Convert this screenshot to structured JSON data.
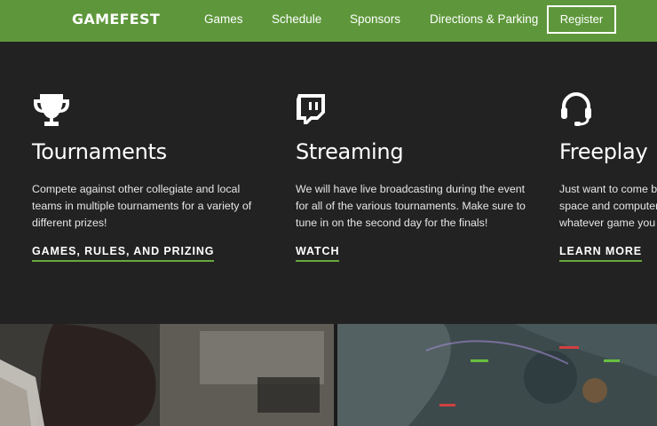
{
  "header": {
    "logo": "GAMEFEST",
    "nav": [
      "Games",
      "Schedule",
      "Sponsors",
      "Directions & Parking"
    ],
    "register_label": "Register"
  },
  "features": [
    {
      "icon": "trophy-icon",
      "title": "Tournaments",
      "body": "Compete against other collegiate and local teams in multiple tournaments for a variety of different prizes!",
      "cta": "GAMES, RULES, AND PRIZING"
    },
    {
      "icon": "twitch-icon",
      "title": "Streaming",
      "body": "We will have live broadcasting during the event for all of the various tournaments. Make sure to tune in on the second day for the finals!",
      "cta": "WATCH"
    },
    {
      "icon": "headset-icon",
      "title": "Freeplay",
      "body": "Just want to come by and play? We have space and computers set up for you to play whatever game you want.",
      "cta": "LEARN MORE"
    }
  ],
  "colors": {
    "header_bg": "#5e973b",
    "page_bg": "#222222",
    "accent_underline": "#6aa83f",
    "text": "#ffffff"
  }
}
